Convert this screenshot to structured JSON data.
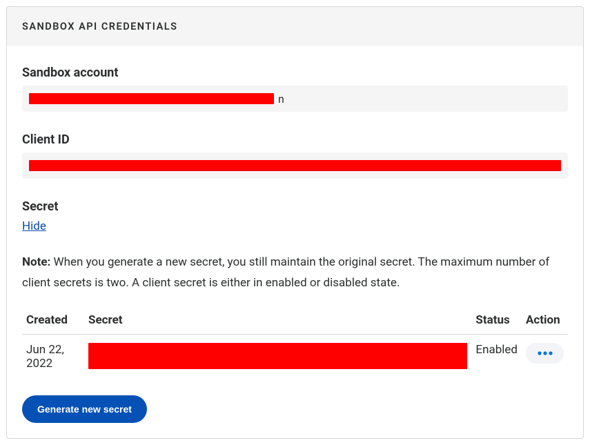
{
  "panel": {
    "title": "SANDBOX API CREDENTIALS"
  },
  "sandbox_account": {
    "label": "Sandbox account",
    "trailing_visible": "n"
  },
  "client_id": {
    "label": "Client ID"
  },
  "secret_section": {
    "label": "Secret",
    "toggle_label": "Hide"
  },
  "note": {
    "label": "Note:",
    "text": " When you generate a new secret, you still maintain the original secret. The maximum number of client secrets is two. A client secret is either in enabled or disabled state."
  },
  "table": {
    "headers": {
      "created": "Created",
      "secret": "Secret",
      "status": "Status",
      "action": "Action"
    },
    "rows": [
      {
        "created": "Jun 22, 2022",
        "status": "Enabled"
      }
    ]
  },
  "buttons": {
    "generate": "Generate new secret"
  }
}
